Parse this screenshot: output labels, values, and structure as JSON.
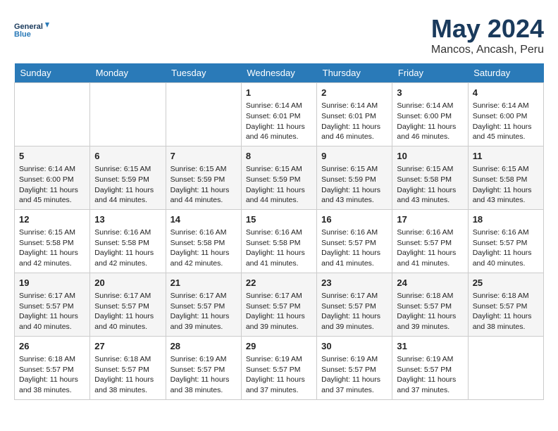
{
  "header": {
    "logo_line1": "General",
    "logo_line2": "Blue",
    "month": "May 2024",
    "location": "Mancos, Ancash, Peru"
  },
  "weekdays": [
    "Sunday",
    "Monday",
    "Tuesday",
    "Wednesday",
    "Thursday",
    "Friday",
    "Saturday"
  ],
  "weeks": [
    [
      {
        "day": "",
        "info": ""
      },
      {
        "day": "",
        "info": ""
      },
      {
        "day": "",
        "info": ""
      },
      {
        "day": "1",
        "info": "Sunrise: 6:14 AM\nSunset: 6:01 PM\nDaylight: 11 hours\nand 46 minutes."
      },
      {
        "day": "2",
        "info": "Sunrise: 6:14 AM\nSunset: 6:01 PM\nDaylight: 11 hours\nand 46 minutes."
      },
      {
        "day": "3",
        "info": "Sunrise: 6:14 AM\nSunset: 6:00 PM\nDaylight: 11 hours\nand 46 minutes."
      },
      {
        "day": "4",
        "info": "Sunrise: 6:14 AM\nSunset: 6:00 PM\nDaylight: 11 hours\nand 45 minutes."
      }
    ],
    [
      {
        "day": "5",
        "info": "Sunrise: 6:14 AM\nSunset: 6:00 PM\nDaylight: 11 hours\nand 45 minutes."
      },
      {
        "day": "6",
        "info": "Sunrise: 6:15 AM\nSunset: 5:59 PM\nDaylight: 11 hours\nand 44 minutes."
      },
      {
        "day": "7",
        "info": "Sunrise: 6:15 AM\nSunset: 5:59 PM\nDaylight: 11 hours\nand 44 minutes."
      },
      {
        "day": "8",
        "info": "Sunrise: 6:15 AM\nSunset: 5:59 PM\nDaylight: 11 hours\nand 44 minutes."
      },
      {
        "day": "9",
        "info": "Sunrise: 6:15 AM\nSunset: 5:59 PM\nDaylight: 11 hours\nand 43 minutes."
      },
      {
        "day": "10",
        "info": "Sunrise: 6:15 AM\nSunset: 5:58 PM\nDaylight: 11 hours\nand 43 minutes."
      },
      {
        "day": "11",
        "info": "Sunrise: 6:15 AM\nSunset: 5:58 PM\nDaylight: 11 hours\nand 43 minutes."
      }
    ],
    [
      {
        "day": "12",
        "info": "Sunrise: 6:15 AM\nSunset: 5:58 PM\nDaylight: 11 hours\nand 42 minutes."
      },
      {
        "day": "13",
        "info": "Sunrise: 6:16 AM\nSunset: 5:58 PM\nDaylight: 11 hours\nand 42 minutes."
      },
      {
        "day": "14",
        "info": "Sunrise: 6:16 AM\nSunset: 5:58 PM\nDaylight: 11 hours\nand 42 minutes."
      },
      {
        "day": "15",
        "info": "Sunrise: 6:16 AM\nSunset: 5:58 PM\nDaylight: 11 hours\nand 41 minutes."
      },
      {
        "day": "16",
        "info": "Sunrise: 6:16 AM\nSunset: 5:57 PM\nDaylight: 11 hours\nand 41 minutes."
      },
      {
        "day": "17",
        "info": "Sunrise: 6:16 AM\nSunset: 5:57 PM\nDaylight: 11 hours\nand 41 minutes."
      },
      {
        "day": "18",
        "info": "Sunrise: 6:16 AM\nSunset: 5:57 PM\nDaylight: 11 hours\nand 40 minutes."
      }
    ],
    [
      {
        "day": "19",
        "info": "Sunrise: 6:17 AM\nSunset: 5:57 PM\nDaylight: 11 hours\nand 40 minutes."
      },
      {
        "day": "20",
        "info": "Sunrise: 6:17 AM\nSunset: 5:57 PM\nDaylight: 11 hours\nand 40 minutes."
      },
      {
        "day": "21",
        "info": "Sunrise: 6:17 AM\nSunset: 5:57 PM\nDaylight: 11 hours\nand 39 minutes."
      },
      {
        "day": "22",
        "info": "Sunrise: 6:17 AM\nSunset: 5:57 PM\nDaylight: 11 hours\nand 39 minutes."
      },
      {
        "day": "23",
        "info": "Sunrise: 6:17 AM\nSunset: 5:57 PM\nDaylight: 11 hours\nand 39 minutes."
      },
      {
        "day": "24",
        "info": "Sunrise: 6:18 AM\nSunset: 5:57 PM\nDaylight: 11 hours\nand 39 minutes."
      },
      {
        "day": "25",
        "info": "Sunrise: 6:18 AM\nSunset: 5:57 PM\nDaylight: 11 hours\nand 38 minutes."
      }
    ],
    [
      {
        "day": "26",
        "info": "Sunrise: 6:18 AM\nSunset: 5:57 PM\nDaylight: 11 hours\nand 38 minutes."
      },
      {
        "day": "27",
        "info": "Sunrise: 6:18 AM\nSunset: 5:57 PM\nDaylight: 11 hours\nand 38 minutes."
      },
      {
        "day": "28",
        "info": "Sunrise: 6:19 AM\nSunset: 5:57 PM\nDaylight: 11 hours\nand 38 minutes."
      },
      {
        "day": "29",
        "info": "Sunrise: 6:19 AM\nSunset: 5:57 PM\nDaylight: 11 hours\nand 37 minutes."
      },
      {
        "day": "30",
        "info": "Sunrise: 6:19 AM\nSunset: 5:57 PM\nDaylight: 11 hours\nand 37 minutes."
      },
      {
        "day": "31",
        "info": "Sunrise: 6:19 AM\nSunset: 5:57 PM\nDaylight: 11 hours\nand 37 minutes."
      },
      {
        "day": "",
        "info": ""
      }
    ]
  ]
}
